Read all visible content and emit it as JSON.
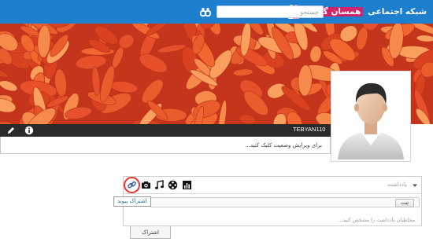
{
  "header": {
    "site_name": "شبکه اجتماعی",
    "brand_name": "همسان گزینی",
    "search_placeholder": "جستجو",
    "search_icon": "binoculars-icon",
    "brand_color": "#1e7fce",
    "accent_color": "#d1226a"
  },
  "profile": {
    "username": "TEBYAN110",
    "status_placeholder": "برای ویرایش وضعیت کلیک کنید...",
    "edit_icon": "pencil-icon",
    "info_icon": "info-icon",
    "avatar": "default-male-avatar"
  },
  "composer": {
    "note_placeholder": "یادداشت",
    "tools": [
      "link-icon",
      "camera-icon",
      "music-icon",
      "film-icon",
      "chart-icon"
    ],
    "highlighted_tool": "link-icon",
    "highlight_color": "#e2342b",
    "tooltip": "اشتراک پیوند",
    "submit_label": "ثبت",
    "privacy_hint": "مخاطبان یادداشت را مشخص کنید...",
    "share_label": "اشتراک"
  }
}
